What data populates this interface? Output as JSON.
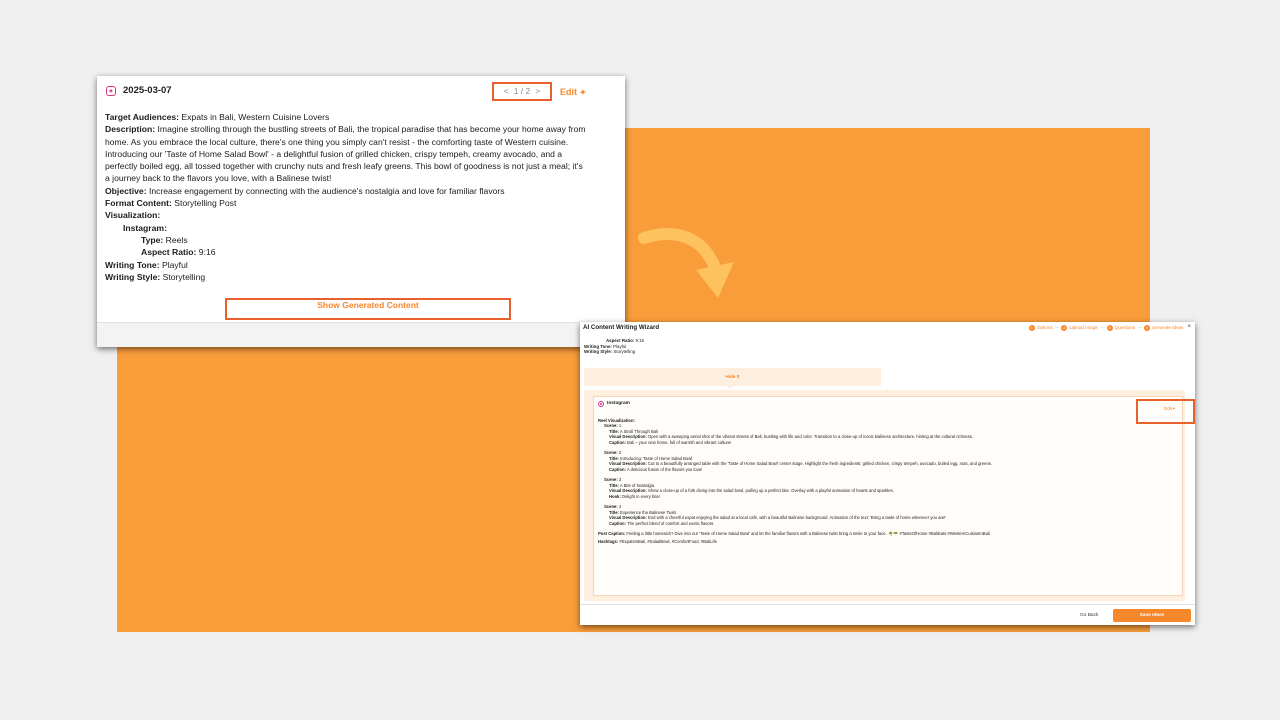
{
  "card": {
    "date": "2025-03-07",
    "pager": {
      "prev": "<",
      "text": "1 / 2",
      "next": ">"
    },
    "edit_label": "Edit",
    "target_audiences": {
      "label": "Target Audiences:",
      "value": " Expats in Bali, Western Cuisine Lovers"
    },
    "description": {
      "label": "Description:",
      "value": " Imagine strolling through the bustling streets of Bali, the tropical paradise that has become your home away from home. As you embrace the local culture, there's one thing you simply can't resist - the comforting taste of Western cuisine. Introducing our 'Taste of Home Salad Bowl' - a delightful fusion of grilled chicken, crispy tempeh, creamy avocado, and a perfectly boiled egg, all tossed together with crunchy nuts and fresh leafy greens. This bowl of goodness is not just a meal; it's a journey back to the flavors you love, with a Balinese twist!"
    },
    "objective": {
      "label": "Objective:",
      "value": " Increase engagement by connecting with the audience's nostalgia and love for familiar flavors"
    },
    "format_content": {
      "label": "Format Content:",
      "value": " Storytelling Post"
    },
    "visualization_label": "Visualization:",
    "instagram_label": "Instagram:",
    "type": {
      "label": "Type:",
      "value": " Reels"
    },
    "aspect_ratio": {
      "label": "Aspect Ratio:",
      "value": " 9:16"
    },
    "writing_tone": {
      "label": "Writing Tone:",
      "value": " Playful"
    },
    "writing_style": {
      "label": "Writing Style:",
      "value": " Storytelling"
    },
    "show_generated": "Show Generated Content"
  },
  "wizard": {
    "title": "AI Content Writing Wizard",
    "steps": [
      {
        "num": "1",
        "label": "Options"
      },
      {
        "num": "2",
        "label": "Upload Image"
      },
      {
        "num": "3",
        "label": "Questions"
      },
      {
        "num": "4",
        "label": "Generate Ideas"
      }
    ],
    "close": "×",
    "preview": {
      "aspect_label": "Aspect Ratio:",
      "aspect_value": " 9:16",
      "tone_label": "Writing Tone:",
      "tone_value": " Playful",
      "style_label": "Writing Style:",
      "style_value": " Storytelling"
    },
    "hide_label": "Hide It",
    "platform": "Instagram",
    "edit_label": "Edit",
    "reel_label": "Reel Visualization:",
    "scenes": [
      {
        "label": "Scene:",
        "num": " 1",
        "title_label": "Title:",
        "title": " A Stroll Through Bali",
        "visual_label": "Visual Description:",
        "visual": " Open with a sweeping aerial shot of the vibrant streets of Bali, bustling with life and color. Transition to a close-up of iconic Balinese architecture, hinting at the cultural richness.",
        "extra_label": "Caption:",
        "extra": " Bali – your new home, full of warmth and vibrant culture!"
      },
      {
        "label": "Scene:",
        "num": " 2",
        "title_label": "Title:",
        "title": " Introducing: Taste of Home Salad Bowl",
        "visual_label": "Visual Description:",
        "visual": " Cut to a beautifully arranged table with the 'Taste of Home Salad Bowl' center stage. Highlight the fresh ingredients: grilled chicken, crispy tempeh, avocado, boiled egg, nuts, and greens.",
        "extra_label": "Caption:",
        "extra": " A delicious fusion of the flavors you love!"
      },
      {
        "label": "Scene:",
        "num": " 3",
        "title_label": "Title:",
        "title": " A Bite of Nostalgia",
        "visual_label": "Visual Description:",
        "visual": " Show a close-up of a fork diving into the salad bowl, pulling up a perfect bite. Overlay with a playful animation of hearts and sparkles.",
        "extra_label": "Hook:",
        "extra": " Delight in every bite!"
      },
      {
        "label": "Scene:",
        "num": " 4",
        "title_label": "Title:",
        "title": " Experience the Balinese Twist",
        "visual_label": "Visual Description:",
        "visual": " End with a cheerful expat enjoying the salad at a local café, with a beautiful Balinese background. Animation of the text: 'Bring a taste of home wherever you are!'",
        "extra_label": "Caption:",
        "extra": " The perfect blend of comfort and exotic flavors."
      }
    ],
    "post_caption_label": "Post Caption:",
    "post_caption": " Feeling a little homesick? Dive into our 'Taste of Home Salad Bowl' and let the familiar flavors with a Balinese twist bring a smile to your face. 🌴🥗 #TasteOfHome #BaliEats #WesternCuisineInBali",
    "hashtags_label": "Hashtags:",
    "hashtags": " #ExpatsInBali, #SaladBowl, #ComfortFood, #BaliLife",
    "go_back": "Go Back",
    "save": "Save Ideas"
  },
  "colors": {
    "accent": "#f7872b",
    "highlight_box": "#e8612c",
    "background_orange": "#f99d3a",
    "page_bg": "#f0f0f0"
  }
}
